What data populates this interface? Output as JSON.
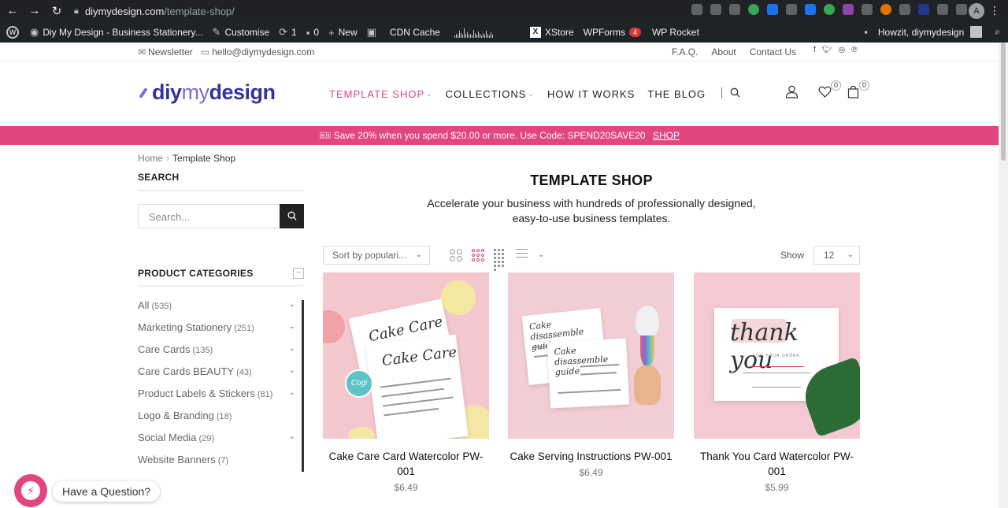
{
  "browser": {
    "url_host": "diymydesign.com",
    "url_path": "/template-shop/",
    "profile_initial": "A"
  },
  "wp_admin": {
    "site_name": "Diy My Design - Business Stationery...",
    "customise": "Customise",
    "updates": "1",
    "comments": "0",
    "new": "New",
    "cdn_cache": "CDN Cache",
    "xstore": "XStore",
    "wpforms": "WPForms",
    "wpforms_badge": "4",
    "wp_rocket": "WP Rocket",
    "greeting": "Howzit, diymydesign"
  },
  "topbar": {
    "newsletter": "Newsletter",
    "email": "hello@diymydesign.com",
    "links": [
      "F.A.Q.",
      "About",
      "Contact Us"
    ],
    "social": [
      "f",
      "t",
      "ig",
      "p"
    ]
  },
  "header": {
    "logo": {
      "diy": "diy",
      "my": "my",
      "design": "design"
    },
    "nav": [
      {
        "label": "TEMPLATE SHOP",
        "active": true,
        "caret": true
      },
      {
        "label": "COLLECTIONS",
        "active": false,
        "caret": true
      },
      {
        "label": "HOW IT WORKS",
        "active": false,
        "caret": false
      },
      {
        "label": "THE BLOG",
        "active": false,
        "caret": false
      }
    ],
    "wishlist_count": "0",
    "cart_count": "0"
  },
  "promo": {
    "text": "Save 20% when you spend $20.00 or more. Use Code: SPEND20SAVE20",
    "link": "SHOP"
  },
  "breadcrumb": {
    "home": "Home",
    "current": "Template Shop"
  },
  "sidebar": {
    "search_title": "SEARCH",
    "search_placeholder": "Search...",
    "categories_title": "PRODUCT CATEGORIES",
    "categories": [
      {
        "name": "All",
        "count": "(535)",
        "expandable": true
      },
      {
        "name": "Marketing Stationery",
        "count": "(251)",
        "expandable": true
      },
      {
        "name": "Care Cards",
        "count": "(135)",
        "expandable": true
      },
      {
        "name": "Care Cards BEAUTY",
        "count": "(43)",
        "expandable": true
      },
      {
        "name": "Product Labels & Stickers",
        "count": "(81)",
        "expandable": true
      },
      {
        "name": "Logo & Branding",
        "count": "(18)",
        "expandable": false
      },
      {
        "name": "Social Media",
        "count": "(29)",
        "expandable": true
      },
      {
        "name": "Website Banners",
        "count": "(7)",
        "expandable": false
      }
    ]
  },
  "main": {
    "title": "TEMPLATE SHOP",
    "subtitle_line1": "Accelerate your business with hundreds of professionally designed,",
    "subtitle_line2": "easy-to-use business templates.",
    "sort_value": "Sort by populari...",
    "show_label": "Show",
    "show_value": "12",
    "products": [
      {
        "title": "Cake Care Card Watercolor PW-001",
        "price": "$6.49",
        "art_text": "Cake Care",
        "badge": "Cogi"
      },
      {
        "title": "Cake Serving Instructions PW-001",
        "price": "$6.49",
        "art_text": "Cake disassemble guide"
      },
      {
        "title": "Thank You Card Watercolor PW-001",
        "price": "$5.99",
        "art_text": "thank you",
        "art_sub": "FOR YOUR ORDER"
      }
    ]
  },
  "chat": {
    "label": "Have a Question?"
  },
  "colors": {
    "accent": "#e2457f",
    "logo": "#35339c",
    "logo_light": "#7b6fcc"
  }
}
